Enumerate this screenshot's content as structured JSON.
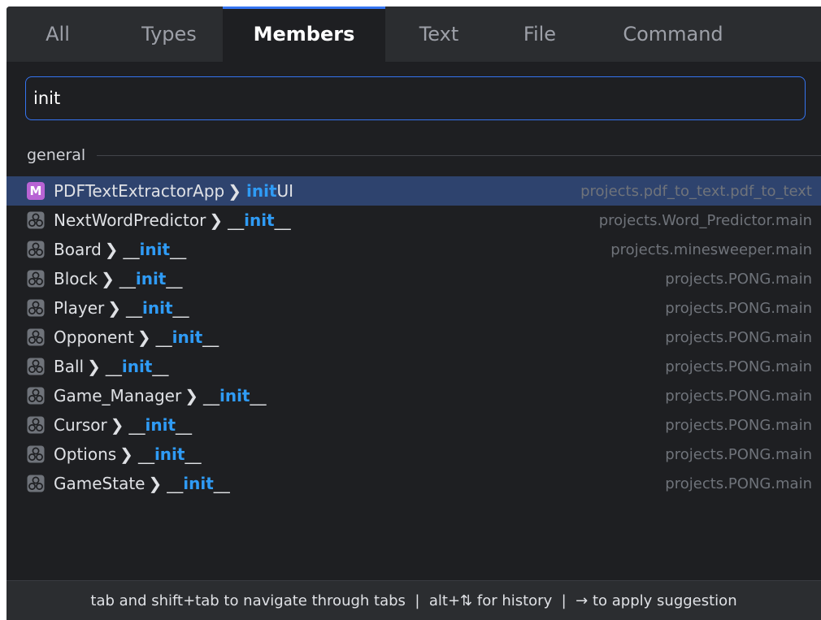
{
  "tabs": [
    {
      "label": "All",
      "active": false
    },
    {
      "label": "Types",
      "active": false
    },
    {
      "label": "Members",
      "active": true
    },
    {
      "label": "Text",
      "active": false
    },
    {
      "label": "File",
      "active": false
    },
    {
      "label": "Command",
      "active": false
    }
  ],
  "search": {
    "value": "init"
  },
  "group": {
    "label": "general"
  },
  "results": [
    {
      "icon": "method-icon",
      "icon_text": "M",
      "class": "PDFTextExtractorApp",
      "before": "",
      "match": "init",
      "after": "UI",
      "path": "projects.pdf_to_text.pdf_to_text",
      "selected": true
    },
    {
      "icon": "class-constructor-icon",
      "class": "NextWordPredictor",
      "before": "__",
      "match": "init",
      "after": "__",
      "path": "projects.Word_Predictor.main"
    },
    {
      "icon": "class-constructor-icon",
      "class": "Board",
      "before": "__",
      "match": "init",
      "after": "__",
      "path": "projects.minesweeper.main"
    },
    {
      "icon": "class-constructor-icon",
      "class": "Block",
      "before": "__",
      "match": "init",
      "after": "__",
      "path": "projects.PONG.main"
    },
    {
      "icon": "class-constructor-icon",
      "class": "Player",
      "before": "__",
      "match": "init",
      "after": "__",
      "path": "projects.PONG.main"
    },
    {
      "icon": "class-constructor-icon",
      "class": "Opponent",
      "before": "__",
      "match": "init",
      "after": "__",
      "path": "projects.PONG.main"
    },
    {
      "icon": "class-constructor-icon",
      "class": "Ball",
      "before": "__",
      "match": "init",
      "after": "__",
      "path": "projects.PONG.main"
    },
    {
      "icon": "class-constructor-icon",
      "class": "Game_Manager",
      "before": "__",
      "match": "init",
      "after": "__",
      "path": "projects.PONG.main"
    },
    {
      "icon": "class-constructor-icon",
      "class": "Cursor",
      "before": "__",
      "match": "init",
      "after": "__",
      "path": "projects.PONG.main"
    },
    {
      "icon": "class-constructor-icon",
      "class": "Options",
      "before": "__",
      "match": "init",
      "after": "__",
      "path": "projects.PONG.main"
    },
    {
      "icon": "class-constructor-icon",
      "class": "GameState",
      "before": "__",
      "match": "init",
      "after": "__",
      "path": "projects.PONG.main"
    }
  ],
  "footer": {
    "hint": "tab and shift+tab to navigate through tabs  |  alt+⇅ for history  |  → to apply suggestion"
  },
  "colors": {
    "accent": "#3574f0",
    "match": "#2f9bf5",
    "selected_row": "#2e436e",
    "method_icon": "#b863d4"
  }
}
